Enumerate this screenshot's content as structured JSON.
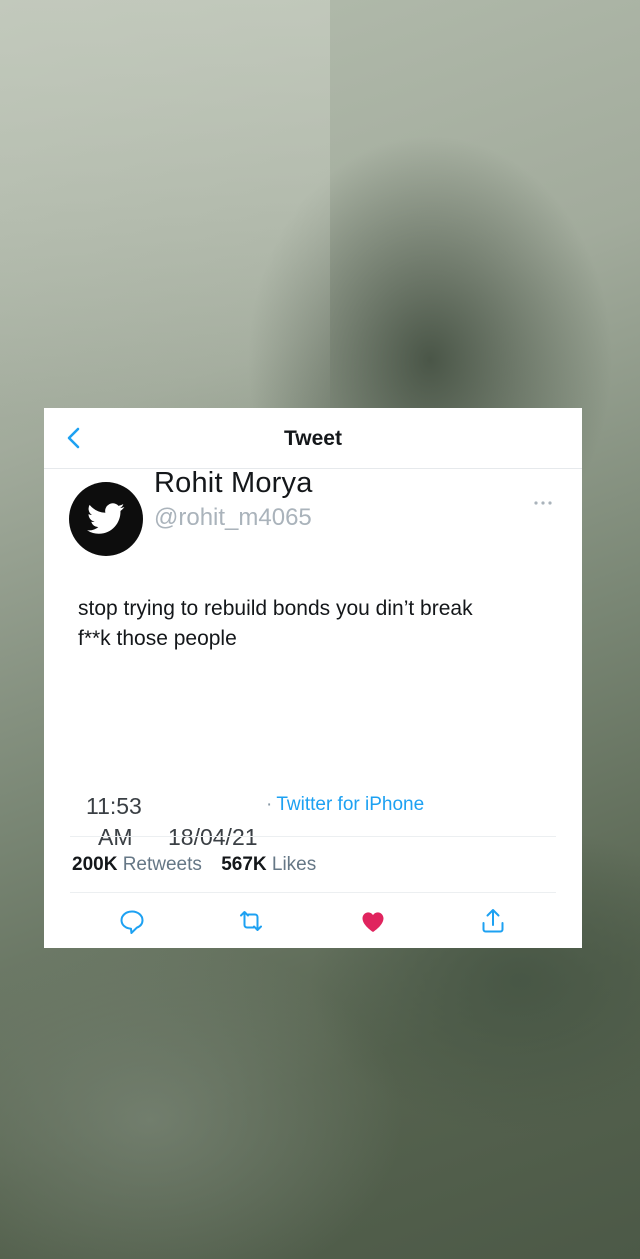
{
  "header": {
    "title": "Tweet"
  },
  "author": {
    "display_name": "Rohit Morya",
    "handle": "@rohit_m4065",
    "avatar_icon": "twitter-bird-icon"
  },
  "tweet": {
    "lines": [
      "stop trying to rebuild bonds you din’t break",
      "f**k those people"
    ],
    "time": "11:53",
    "ampm": "AM",
    "date": "18/04/21",
    "source": "Twitter for iPhone"
  },
  "stats": {
    "retweets_count": "200K",
    "retweets_label": "Retweets",
    "likes_count": "567K",
    "likes_label": "Likes"
  },
  "icons": {
    "back": "chevron-left-icon",
    "more": "more-dots-icon",
    "reply": "reply-icon",
    "retweet": "retweet-icon",
    "like": "heart-icon",
    "share": "share-icon"
  },
  "colors": {
    "accent": "#1da1f2",
    "like": "#e0245e",
    "text": "#14171a",
    "muted": "#657786"
  }
}
